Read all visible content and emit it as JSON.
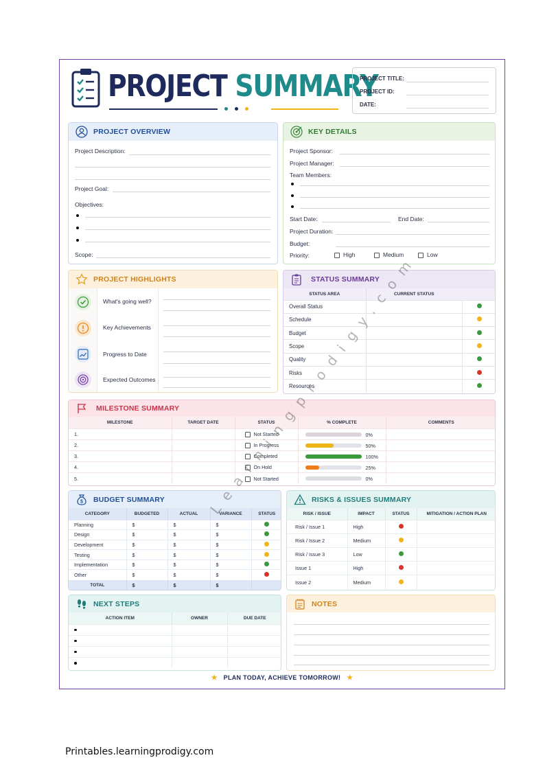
{
  "header": {
    "title_part1": "PROJECT",
    "title_part2": "SUMMARY",
    "fields": [
      "PROJECT TITLE:",
      "PROJECT ID:",
      "DATE:"
    ]
  },
  "overview": {
    "title": "PROJECT OVERVIEW",
    "description_label": "Project Description:",
    "goal_label": "Project Goal:",
    "objectives_label": "Objectives:",
    "scope_label": "Scope:"
  },
  "key_details": {
    "title": "KEY DETAILS",
    "sponsor_label": "Project Sponsor:",
    "manager_label": "Project Manager:",
    "team_label": "Team Members:",
    "start_label": "Start Date:",
    "end_label": "End Date:",
    "duration_label": "Project Duration:",
    "budget_label": "Budget:",
    "priority_label": "Priority:",
    "priority_options": [
      "High",
      "Medium",
      "Low"
    ]
  },
  "highlights": {
    "title": "PROJECT HIGHLIGHTS",
    "items": [
      "What's going well?",
      "Key Achievements",
      "Progress to Date",
      "Expected Outcomes"
    ]
  },
  "status_summary": {
    "title": "STATUS SUMMARY",
    "headers": [
      "STATUS AREA",
      "CURRENT STATUS"
    ],
    "rows": [
      {
        "area": "Overall Status",
        "status": "green"
      },
      {
        "area": "Schedule",
        "status": "yellow"
      },
      {
        "area": "Budget",
        "status": "green"
      },
      {
        "area": "Scope",
        "status": "yellow"
      },
      {
        "area": "Quality",
        "status": "green"
      },
      {
        "area": "Risks",
        "status": "red"
      },
      {
        "area": "Resources",
        "status": "green"
      }
    ]
  },
  "milestones": {
    "title": "MILESTONE SUMMARY",
    "headers": [
      "MILESTONE",
      "TARGET DATE",
      "STATUS",
      "% COMPLETE",
      "COMMENTS"
    ],
    "rows": [
      {
        "num": "1.",
        "status": "Not Started",
        "percent": "0%",
        "fraction": 0,
        "color": "#d9c6cf"
      },
      {
        "num": "2.",
        "status": "In Progress",
        "percent": "50%",
        "fraction": 0.5,
        "color": "#f0b417"
      },
      {
        "num": "3.",
        "status": "Completed",
        "percent": "100%",
        "fraction": 1,
        "color": "#3a9a3c"
      },
      {
        "num": "4.",
        "status": "On Hold",
        "percent": "25%",
        "fraction": 0.25,
        "color": "#ef7d1a"
      },
      {
        "num": "5.",
        "status": "Not Started",
        "percent": "0%",
        "fraction": 0,
        "color": "#d9d9d9"
      }
    ]
  },
  "budget": {
    "title": "BUDGET SUMMARY",
    "headers": [
      "CATEGORY",
      "BUDGETED",
      "ACTUAL",
      "VARIANCE",
      "STATUS"
    ],
    "rows": [
      {
        "category": "Planning",
        "status": "green"
      },
      {
        "category": "Design",
        "status": "green"
      },
      {
        "category": "Development",
        "status": "yellow"
      },
      {
        "category": "Testing",
        "status": "yellow"
      },
      {
        "category": "Implementation",
        "status": "green"
      },
      {
        "category": "Other",
        "status": "red"
      }
    ],
    "total_label": "TOTAL",
    "currency": "$"
  },
  "risks": {
    "title": "RISKS & ISSUES SUMMARY",
    "headers": [
      "RISK / ISSUE",
      "IMPACT",
      "STATUS",
      "MITIGATION / ACTION PLAN"
    ],
    "rows": [
      {
        "name": "Risk / Issue 1",
        "impact": "High",
        "status": "red"
      },
      {
        "name": "Risk / Issue 2",
        "impact": "Medium",
        "status": "yellow"
      },
      {
        "name": "Risk / Issue 3",
        "impact": "Low",
        "status": "green"
      },
      {
        "name": "Issue 1",
        "impact": "High",
        "status": "red"
      },
      {
        "name": "Issue 2",
        "impact": "Medium",
        "status": "yellow"
      }
    ]
  },
  "next_steps": {
    "title": "NEXT STEPS",
    "headers": [
      "ACTION ITEM",
      "OWNER",
      "DUE DATE"
    ]
  },
  "notes": {
    "title": "NOTES"
  },
  "footer": {
    "tagline": "PLAN TODAY, ACHIEVE TOMORROW!"
  },
  "watermark": "Learningprodigy.com",
  "source": "Printables.learningprodigy.com",
  "colors": {
    "navy": "#1f2a5c",
    "teal": "#1e8a8a",
    "blue_head": "#e6eef9",
    "green_head": "#e9f3e4",
    "orange_head": "#fdf1de",
    "purple_head": "#ece6f5",
    "pink_head": "#fbe3e7",
    "mint_head": "#e3f3f1"
  }
}
